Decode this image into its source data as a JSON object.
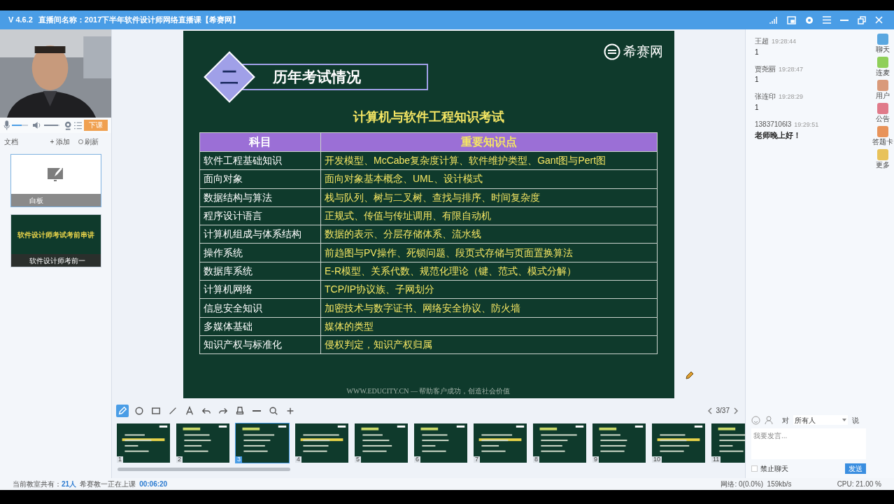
{
  "title_bar": {
    "version": "V 4.6.2",
    "title": "直播间名称：2017下半年软件设计师网络直播课【希赛网】"
  },
  "media_controls": {
    "mic": {
      "level": 0.6
    },
    "speaker": {
      "level": 0.9
    },
    "end_button": "下课"
  },
  "documents": {
    "header": "文档",
    "add": "+ 添加",
    "refresh": "刷新",
    "items": [
      {
        "kind": "whiteboard",
        "caption": "白板",
        "selected": true
      },
      {
        "kind": "slides",
        "title": "软件设计师考试考前串讲",
        "caption": "软件设计师考前一",
        "selected": false
      }
    ]
  },
  "slide": {
    "logo": "希赛网",
    "section_number": "二",
    "section_title": "历年考试情况",
    "heading": "计算机与软件工程知识考试",
    "columns": [
      "科目",
      "重要知识点"
    ],
    "rows": [
      [
        "软件工程基础知识",
        "开发模型、McCabe复杂度计算、软件维护类型、Gant图与Pert图"
      ],
      [
        "面向对象",
        "面向对象基本概念、UML、设计模式"
      ],
      [
        "数据结构与算法",
        "栈与队列、树与二叉树、查找与排序、时间复杂度"
      ],
      [
        "程序设计语言",
        "正规式、传值与传址调用、有限自动机"
      ],
      [
        "计算机组成与体系结构",
        "数据的表示、分层存储体系、流水线"
      ],
      [
        "操作系统",
        "前趋图与PV操作、死锁问题、段页式存储与页面置换算法"
      ],
      [
        "数据库系统",
        "E-R模型、关系代数、规范化理论（键、范式、模式分解）"
      ],
      [
        "计算机网络",
        "TCP/IP协议族、子网划分"
      ],
      [
        "信息安全知识",
        "加密技术与数字证书、网络安全协议、防火墙"
      ],
      [
        "多媒体基础",
        "媒体的类型"
      ],
      [
        "知识产权与标准化",
        "侵权判定，知识产权归属"
      ]
    ],
    "footer": "WWW.EDUCITY.CN — 帮助客户成功，创造社会价值"
  },
  "toolbar": {
    "tools": [
      {
        "kind": "pen",
        "selected": true
      },
      {
        "kind": "circle",
        "selected": false
      },
      {
        "kind": "rect",
        "selected": false
      },
      {
        "kind": "line",
        "selected": false
      },
      {
        "kind": "text",
        "selected": false
      },
      {
        "kind": "undo",
        "selected": false
      },
      {
        "kind": "redo",
        "selected": false
      },
      {
        "kind": "eraser",
        "selected": false
      },
      {
        "kind": "zoom_out",
        "selected": false
      },
      {
        "kind": "zoom",
        "selected": false
      },
      {
        "kind": "zoom_in",
        "selected": false
      }
    ],
    "page": "3/37"
  },
  "thumbnails": [
    {
      "number": "1",
      "selected": false
    },
    {
      "number": "2",
      "selected": false
    },
    {
      "number": "3",
      "selected": true
    },
    {
      "number": "4",
      "selected": false
    },
    {
      "number": "5",
      "selected": false
    },
    {
      "number": "6",
      "selected": false
    },
    {
      "number": "7",
      "selected": false
    },
    {
      "number": "8",
      "selected": false
    },
    {
      "number": "9",
      "selected": false
    },
    {
      "number": "10",
      "selected": false
    },
    {
      "number": "11",
      "selected": false
    }
  ],
  "chat": {
    "messages": [
      {
        "name": "王超",
        "time": "19:28:44",
        "text": "1",
        "bold": false
      },
      {
        "name": "贾尧丽",
        "time": "19:28:47",
        "text": "1",
        "bold": false
      },
      {
        "name": "张连印",
        "time": "19:28:29",
        "text": "1",
        "bold": false
      },
      {
        "name": "13837106l3",
        "time": "19:29:51",
        "text": "老师晚上好！",
        "bold": true
      }
    ],
    "recipient_prefix": "对",
    "recipient": "所有人",
    "recipient_suffix": "说",
    "placeholder": "我要发言...",
    "mute_label": "禁止聊天",
    "mute_checked": false,
    "send": "发送"
  },
  "side_tabs": [
    {
      "label": "聊天",
      "color": "#5aa7e0"
    },
    {
      "label": "连麦",
      "color": "#8fcf5a"
    },
    {
      "label": "用户",
      "color": "#d99a7a"
    },
    {
      "label": "公告",
      "color": "#e07a8a"
    },
    {
      "label": "答题卡",
      "color": "#e8935a"
    },
    {
      "label": "更多",
      "color": "#e8c25a"
    }
  ],
  "status_bar": {
    "classroom": "当前教室共有：",
    "count": "21人",
    "teacher": "希赛教一正在上课",
    "timer": "00:06:20",
    "network": "网络: 0(0.0%)  159kb/s",
    "cpu": "CPU: 21.00 %"
  }
}
